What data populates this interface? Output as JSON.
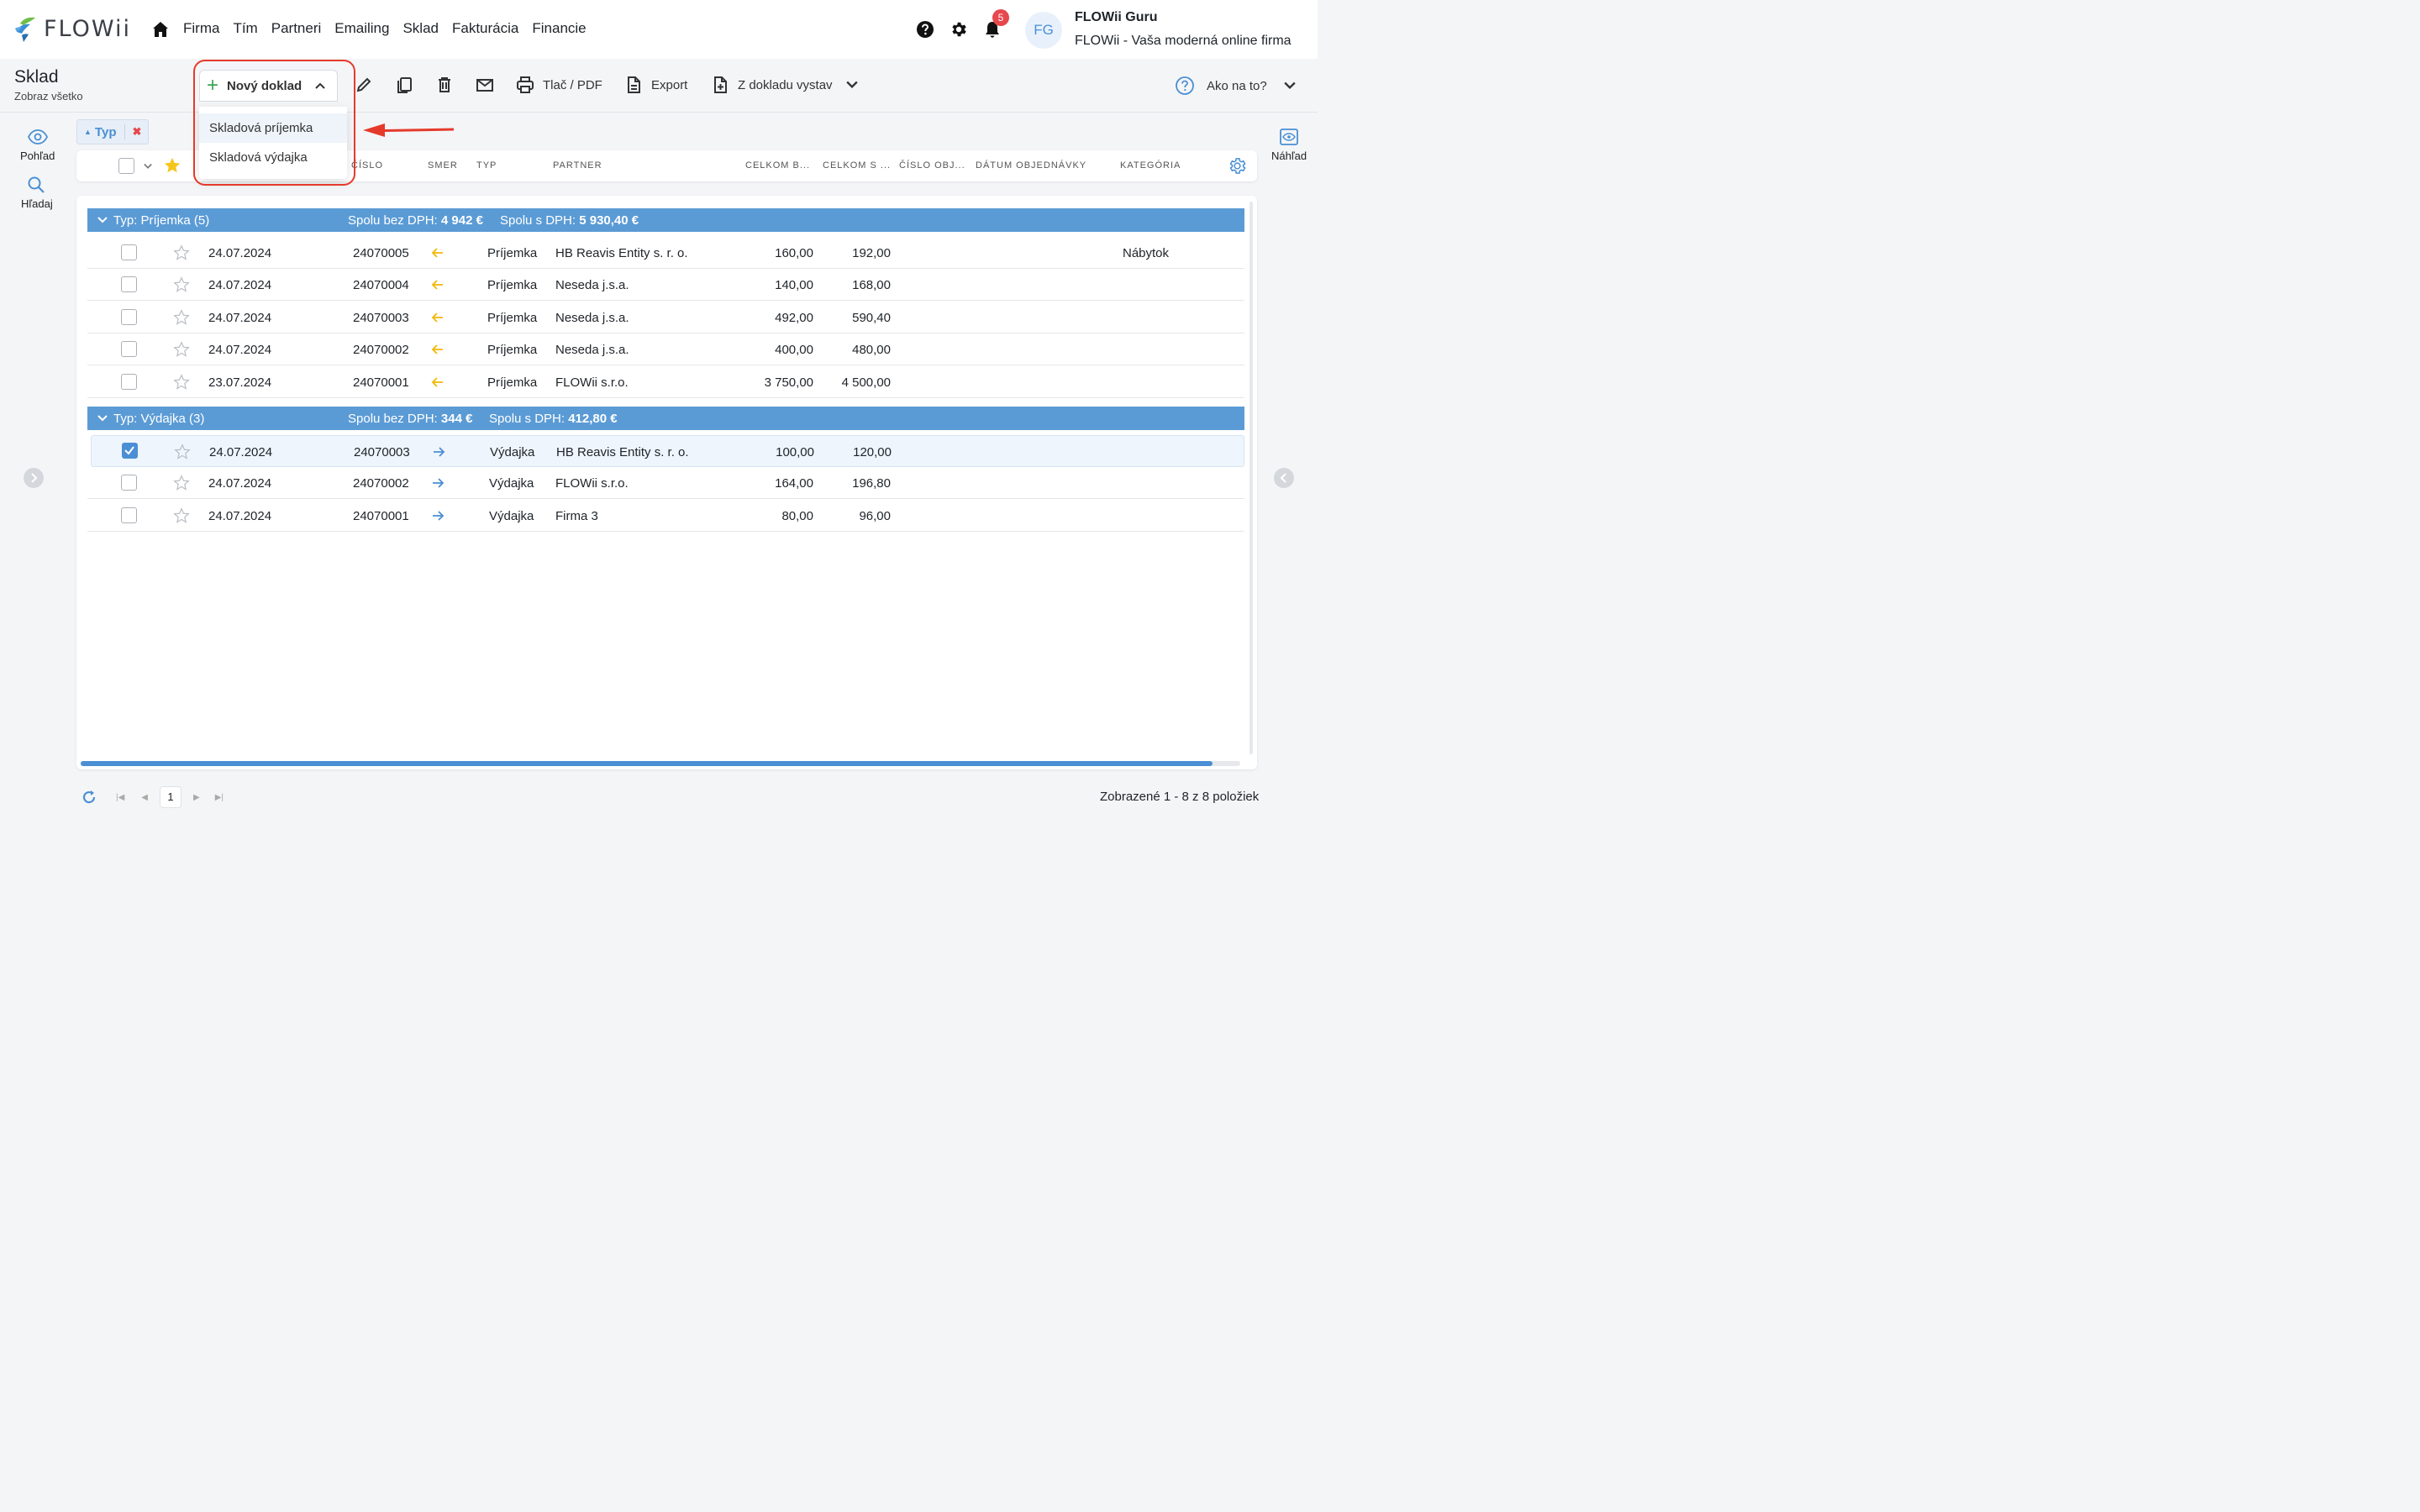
{
  "app": {
    "logo_text": "FLOWii"
  },
  "nav": {
    "items": [
      "Firma",
      "Tím",
      "Partneri",
      "Emailing",
      "Sklad",
      "Fakturácia",
      "Financie"
    ]
  },
  "header_right": {
    "notifications_count": "5",
    "avatar_initials": "FG",
    "user_name": "FLOWii Guru",
    "company": "FLOWii - Vaša moderná online firma"
  },
  "page": {
    "title": "Sklad",
    "subtitle": "Zobraz všetko"
  },
  "toolbar": {
    "new_doc_label": "Nový doklad",
    "print_label": "Tlač / PDF",
    "export_label": "Export",
    "create_from_label": "Z dokladu vystav",
    "help_label": "Ako na to?"
  },
  "dropdown": {
    "items": [
      "Skladová príjemka",
      "Skladová výdajka"
    ]
  },
  "sidebar": {
    "view_label": "Pohľad",
    "search_label": "Hľadaj",
    "preview_label": "Náhľad"
  },
  "filter_chip": {
    "label": "Typ"
  },
  "columns": [
    "ČÍSLO",
    "SMER",
    "TYP",
    "PARTNER",
    "CELKOM B...",
    "CELKOM S ...",
    "ČÍSLO OBJ...",
    "DÁTUM OBJEDNÁVKY",
    "KATEGÓRIA"
  ],
  "groups": [
    {
      "title": "Typ: Príjemka (5)",
      "sum_without_vat_label": "Spolu bez DPH:",
      "sum_without_vat": "4 942 €",
      "sum_with_vat_label": "Spolu s DPH:",
      "sum_with_vat": "5 930,40 €",
      "rows": [
        {
          "date": "24.07.2024",
          "number": "24070005",
          "type": "Príjemka",
          "partner": "HB Reavis Entity s. r. o.",
          "total_without": "160,00",
          "total_with": "192,00",
          "category": "Nábytok",
          "checked": false
        },
        {
          "date": "24.07.2024",
          "number": "24070004",
          "type": "Príjemka",
          "partner": "Neseda j.s.a.",
          "total_without": "140,00",
          "total_with": "168,00",
          "category": "",
          "checked": false
        },
        {
          "date": "24.07.2024",
          "number": "24070003",
          "type": "Príjemka",
          "partner": "Neseda j.s.a.",
          "total_without": "492,00",
          "total_with": "590,40",
          "category": "",
          "checked": false
        },
        {
          "date": "24.07.2024",
          "number": "24070002",
          "type": "Príjemka",
          "partner": "Neseda j.s.a.",
          "total_without": "400,00",
          "total_with": "480,00",
          "category": "",
          "checked": false
        },
        {
          "date": "23.07.2024",
          "number": "24070001",
          "type": "Príjemka",
          "partner": "FLOWii s.r.o.",
          "total_without": "3 750,00",
          "total_with": "4 500,00",
          "category": "",
          "checked": false
        }
      ]
    },
    {
      "title": "Typ: Výdajka (3)",
      "sum_without_vat_label": "Spolu bez DPH:",
      "sum_without_vat": "344 €",
      "sum_with_vat_label": "Spolu s DPH:",
      "sum_with_vat": "412,80 €",
      "rows": [
        {
          "date": "24.07.2024",
          "number": "24070003",
          "type": "Výdajka",
          "partner": "HB Reavis Entity s. r. o.",
          "total_without": "100,00",
          "total_with": "120,00",
          "category": "",
          "checked": true
        },
        {
          "date": "24.07.2024",
          "number": "24070002",
          "type": "Výdajka",
          "partner": "FLOWii s.r.o.",
          "total_without": "164,00",
          "total_with": "196,80",
          "category": "",
          "checked": false
        },
        {
          "date": "24.07.2024",
          "number": "24070001",
          "type": "Výdajka",
          "partner": "Firma 3",
          "total_without": "80,00",
          "total_with": "96,00",
          "category": "",
          "checked": false
        }
      ]
    }
  ],
  "pager": {
    "current_page": "1",
    "info": "Zobrazené 1 - 8 z 8 položiek"
  },
  "colors": {
    "accent": "#4a8fd3",
    "group_bar": "#5b9bd5",
    "incoming_arrow": "#f2b705",
    "outgoing_arrow": "#4a8fd3",
    "highlight": "#e53a2b",
    "star_active": "#f5c518"
  },
  "icons": {
    "incoming": "arrow-left-icon",
    "outgoing": "arrow-right-icon"
  }
}
